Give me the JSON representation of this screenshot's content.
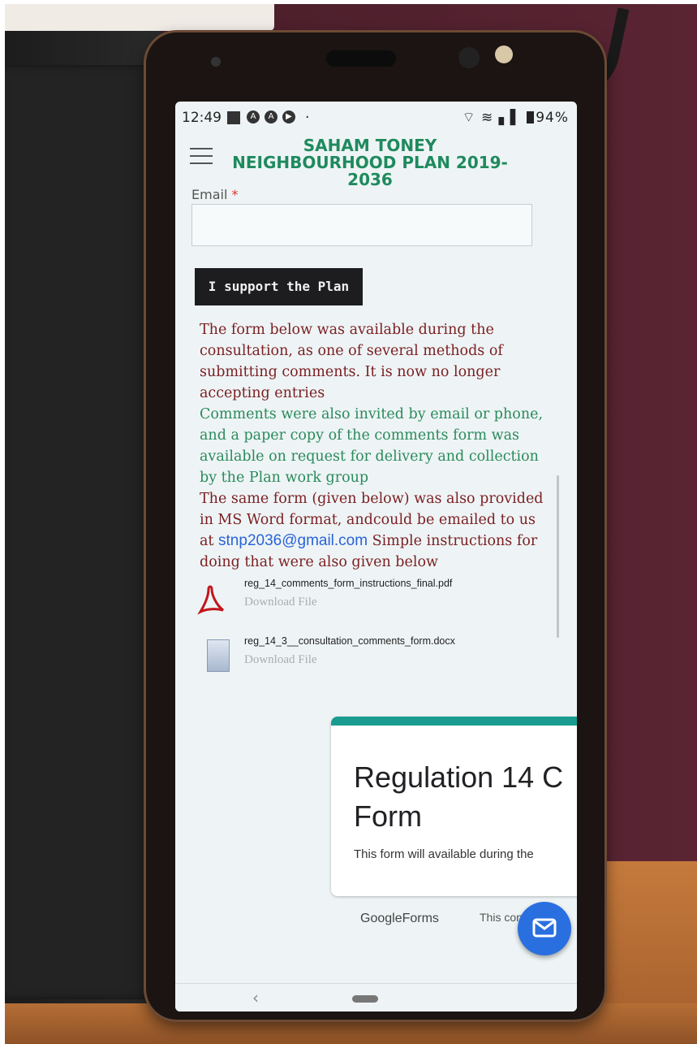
{
  "status_bar": {
    "time": "12:49",
    "icons": [
      "square-icon",
      "circle-a-icon",
      "circle-a-icon",
      "play-icon"
    ],
    "battery": "94%"
  },
  "site": {
    "title_lines": [
      "SAHAM TONEY",
      "NEIGHBOURHOOD PLAN 2019-",
      "2036"
    ]
  },
  "form": {
    "email_label": "Email",
    "required_mark": "*",
    "email_value": ""
  },
  "support_button": "I support the Plan",
  "paragraphs": {
    "p1": "The form below was available during the consultation, as one of several methods of submitting comments. It is now no longer accepting entries",
    "p2": "Comments were also invited by email or phone, and a paper copy of the comments form was available on request for delivery and collection by the Plan work group",
    "p3_before": "The same form (given below) was also provided in MS Word format, andcould be emailed to us at ",
    "p3_link": "stnp2036@gmail.com",
    "p3_after": " Simple instructions for doing that were also given below"
  },
  "files": [
    {
      "name": "reg_14_comments_form_instructions_final.pdf",
      "action": "Download File",
      "icon": "pdf-icon"
    },
    {
      "name": "reg_14_3__consultation_comments_form.docx",
      "action": "Download File",
      "icon": "doc-icon"
    }
  ],
  "google_form": {
    "title_line1": "Regulation 14 C",
    "title_line2": "Form",
    "subtitle": "This form will available during the",
    "brand": "GoogleForms",
    "truncated": "This con"
  },
  "colors": {
    "title_green": "#1f8a5e",
    "maroon": "#7b1e22",
    "green": "#2a8a5c",
    "link": "#2a63d8",
    "fab": "#2a6fe0",
    "form_accent": "#199c8f"
  }
}
